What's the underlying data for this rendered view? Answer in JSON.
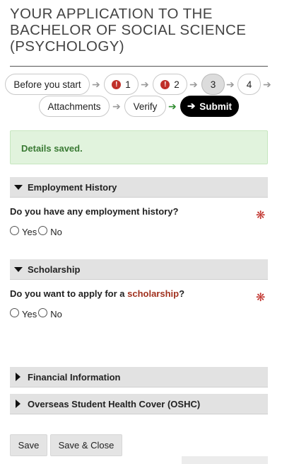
{
  "page": {
    "title": "YOUR APPLICATION TO THE BACHELOR OF SOCIAL SCIENCE (PSYCHOLOGY)"
  },
  "steps": {
    "before": "Before you start",
    "step1": "1",
    "step2": "2",
    "step3": "3",
    "step4": "4",
    "attachments": "Attachments",
    "verify": "Verify",
    "submit": "Submit",
    "error_glyph": "!",
    "arrow_glyph": "➔",
    "submit_arrow_glyph": "➔"
  },
  "alert": {
    "message": "Details saved."
  },
  "sections": {
    "employment": {
      "title": "Employment History",
      "question": "Do you have any employment history?",
      "yes": "Yes",
      "no": "No"
    },
    "scholarship": {
      "title": "Scholarship",
      "question_prefix": "Do you want to apply for a ",
      "question_link": "scholarship",
      "question_suffix": "?",
      "yes": "Yes",
      "no": "No"
    },
    "financial": {
      "title": "Financial Information"
    },
    "oshc": {
      "title": "Overseas Student Health Cover (OSHC)"
    }
  },
  "required_glyph": "❋",
  "buttons": {
    "save": "Save",
    "save_close": "Save & Close"
  },
  "colors": {
    "error_red": "#c0302a",
    "success_green": "#3a7a34",
    "link_red": "#a1321f",
    "section_bg": "#e2e2e2"
  }
}
